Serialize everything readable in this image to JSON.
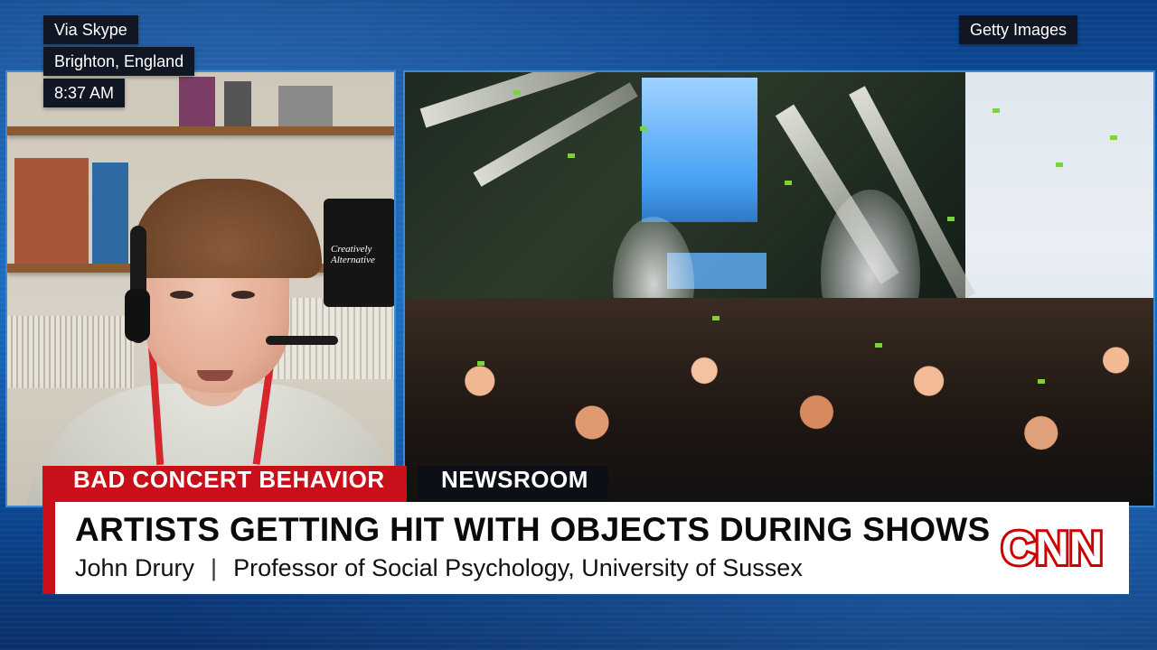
{
  "overlay": {
    "source": "Via Skype",
    "location": "Brighton, England",
    "time": "8:37 AM",
    "credit": "Getty Images"
  },
  "lower_third": {
    "topic": "BAD CONCERT BEHAVIOR",
    "show": "NEWSROOM",
    "headline": "ARTISTS GETTING HIT WITH OBJECTS DURING SHOWS",
    "guest_name": "John Drury",
    "separator": "|",
    "guest_title": "Professor of Social Psychology, University of Sussex"
  },
  "logo": {
    "network": "CNN",
    "color": "#cc0000"
  },
  "bag_text": "Creatively Alternative",
  "colors": {
    "accent_red": "#c9101a",
    "panel_border": "#3b88d6"
  }
}
